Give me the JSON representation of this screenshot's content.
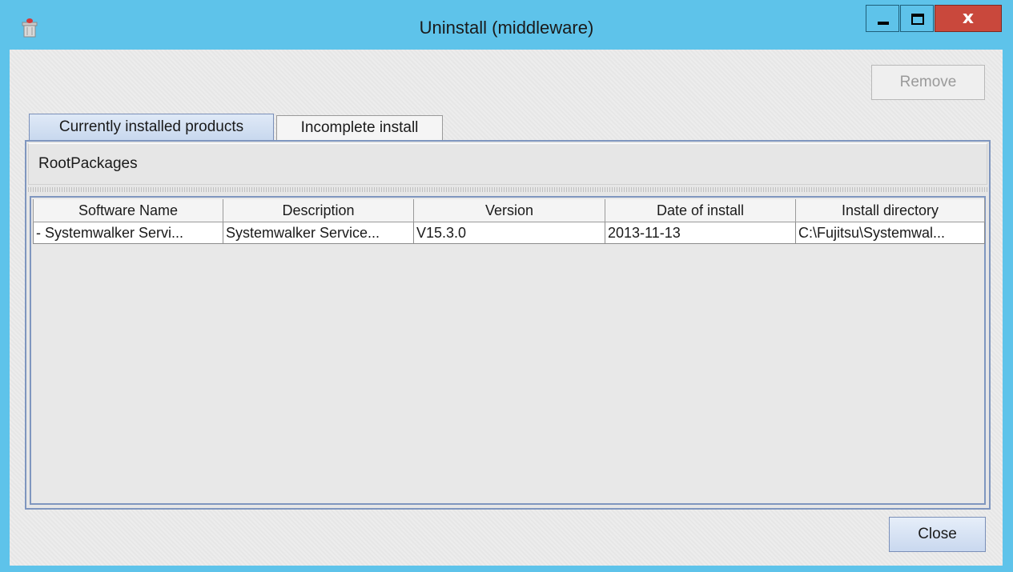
{
  "window": {
    "title": "Uninstall (middleware)",
    "icon": "trash-bin-icon",
    "controls": {
      "minimize": "minimize-icon",
      "maximize": "maximize-icon",
      "close": "x"
    }
  },
  "toolbar": {
    "remove_label": "Remove",
    "remove_enabled": false
  },
  "tabs": [
    {
      "label": "Currently installed products",
      "active": true
    },
    {
      "label": "Incomplete install",
      "active": false
    }
  ],
  "panel": {
    "header": "RootPackages"
  },
  "table": {
    "columns": [
      "Software Name",
      "Description",
      "Version",
      "Date of install",
      "Install directory"
    ],
    "rows": [
      [
        "- Systemwalker Servi...",
        "Systemwalker Service...",
        "V15.3.0",
        "2013-11-13",
        "C:\\Fujitsu\\Systemwal..."
      ]
    ]
  },
  "footer": {
    "close_label": "Close"
  },
  "colors": {
    "title_bar": "#5ec3ea",
    "close_button": "#c9483c",
    "selection_border": "#7f96bf"
  }
}
